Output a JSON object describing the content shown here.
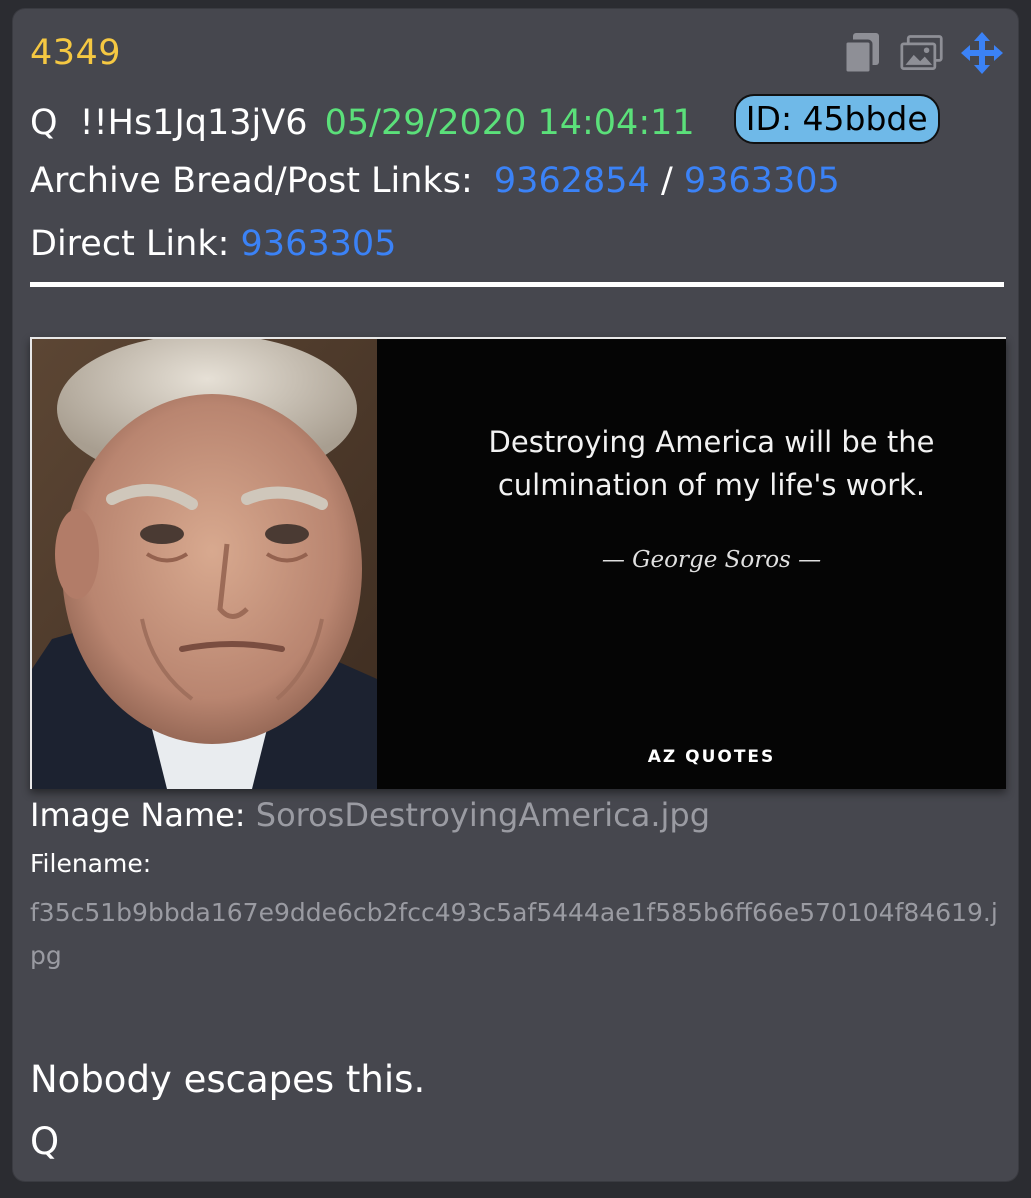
{
  "post": {
    "number": "4349",
    "author": "Q",
    "tripcode": "!!Hs1Jq13jV6",
    "datetime": "05/29/2020 14:04:11",
    "id_badge": "ID: 45bbde"
  },
  "archive": {
    "label": "Archive Bread/Post Links:",
    "bread_link": "9362854",
    "separator": "/",
    "post_link": "9363305"
  },
  "direct": {
    "label": "Direct Link:",
    "link": "9363305"
  },
  "toolbar": {
    "icons": [
      "copy-icon",
      "images-icon",
      "move-icon"
    ]
  },
  "image": {
    "quote_line1": "Destroying America will be the",
    "quote_line2": "culmination of my life's work.",
    "author": "— George Soros —",
    "brand": "AZ QUOTES"
  },
  "meta": {
    "image_name_label": "Image Name:",
    "image_name": "SorosDestroyingAmerica.jpg",
    "filename_label": "Filename:",
    "filename": "f35c51b9bbda167e9dde6cb2fcc493c5af5444ae1f585b6ff66e570104f84619.jpg"
  },
  "message": {
    "line1": "Nobody escapes this.",
    "line2": "Q"
  },
  "colors": {
    "post_number": "#f5c842",
    "datetime": "#5be07a",
    "link": "#3b82f6",
    "id_badge": "#6fb9e8",
    "card_bg": "#46474e"
  }
}
